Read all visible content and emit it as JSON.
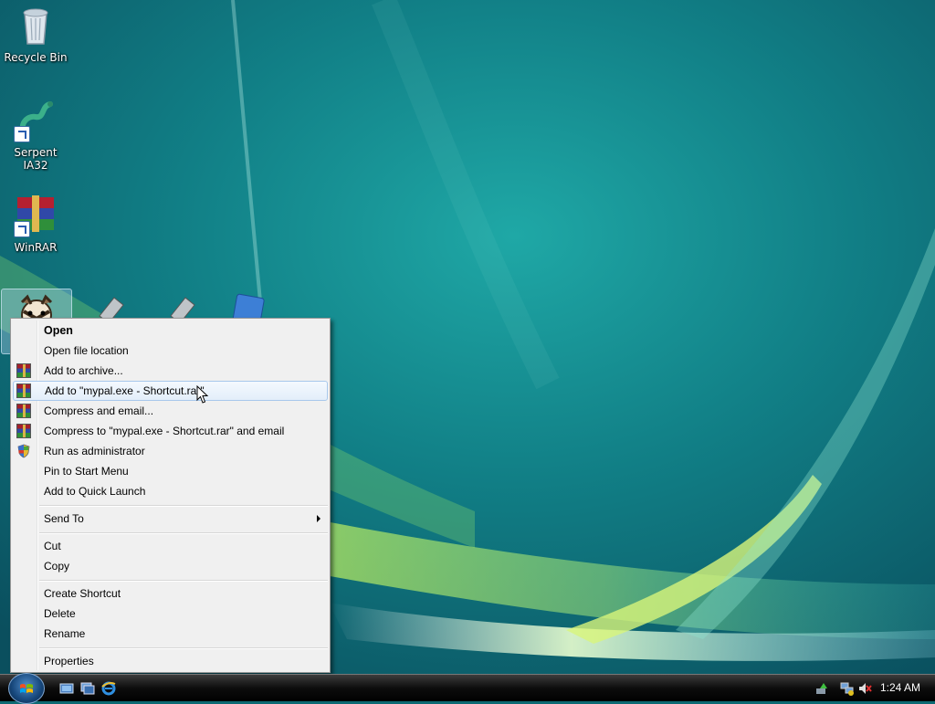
{
  "desktop": {
    "icons": [
      {
        "label": "Recycle Bin",
        "icon": "recycle-bin-icon"
      },
      {
        "label": "Serpent IA32",
        "icon": "serpent-icon"
      },
      {
        "label": "WinRAR",
        "icon": "winrar-icon"
      }
    ],
    "selected_icon": "mypal-icon"
  },
  "context_menu": {
    "items": [
      {
        "label": "Open",
        "bold": true
      },
      {
        "label": "Open file location"
      },
      {
        "label": "Add to archive...",
        "icon": "winrar-icon"
      },
      {
        "label": "Add to \"mypal.exe - Shortcut.rar\"",
        "icon": "winrar-icon",
        "highlighted": true
      },
      {
        "label": "Compress and email...",
        "icon": "winrar-icon"
      },
      {
        "label": "Compress to \"mypal.exe - Shortcut.rar\" and email",
        "icon": "winrar-icon"
      },
      {
        "label": "Run as administrator",
        "icon": "shield-icon"
      },
      {
        "label": "Pin to Start Menu"
      },
      {
        "label": "Add to Quick Launch"
      },
      {
        "label": "Send To",
        "submenu": true
      },
      {
        "label": "Cut"
      },
      {
        "label": "Copy"
      },
      {
        "label": "Create Shortcut"
      },
      {
        "label": "Delete"
      },
      {
        "label": "Rename"
      },
      {
        "label": "Properties"
      }
    ]
  },
  "taskbar": {
    "clock": "1:24 AM",
    "quick_launch": [
      "show-desktop-icon",
      "switch-windows-icon",
      "internet-explorer-icon"
    ],
    "tray_icons": [
      "safely-remove-icon",
      "network-icon",
      "volume-muted-icon"
    ]
  },
  "colors": {
    "menu_bg": "#f0f0f0",
    "highlight_border": "#a8c8ec",
    "taskbar": "#000000"
  }
}
